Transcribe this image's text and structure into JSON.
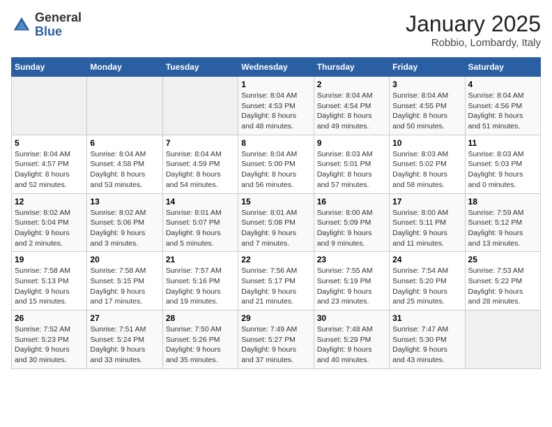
{
  "header": {
    "logo_general": "General",
    "logo_blue": "Blue",
    "month": "January 2025",
    "location": "Robbio, Lombardy, Italy"
  },
  "days_of_week": [
    "Sunday",
    "Monday",
    "Tuesday",
    "Wednesday",
    "Thursday",
    "Friday",
    "Saturday"
  ],
  "weeks": [
    [
      {
        "day": "",
        "info": ""
      },
      {
        "day": "",
        "info": ""
      },
      {
        "day": "",
        "info": ""
      },
      {
        "day": "1",
        "info": "Sunrise: 8:04 AM\nSunset: 4:53 PM\nDaylight: 8 hours\nand 48 minutes."
      },
      {
        "day": "2",
        "info": "Sunrise: 8:04 AM\nSunset: 4:54 PM\nDaylight: 8 hours\nand 49 minutes."
      },
      {
        "day": "3",
        "info": "Sunrise: 8:04 AM\nSunset: 4:55 PM\nDaylight: 8 hours\nand 50 minutes."
      },
      {
        "day": "4",
        "info": "Sunrise: 8:04 AM\nSunset: 4:56 PM\nDaylight: 8 hours\nand 51 minutes."
      }
    ],
    [
      {
        "day": "5",
        "info": "Sunrise: 8:04 AM\nSunset: 4:57 PM\nDaylight: 8 hours\nand 52 minutes."
      },
      {
        "day": "6",
        "info": "Sunrise: 8:04 AM\nSunset: 4:58 PM\nDaylight: 8 hours\nand 53 minutes."
      },
      {
        "day": "7",
        "info": "Sunrise: 8:04 AM\nSunset: 4:59 PM\nDaylight: 8 hours\nand 54 minutes."
      },
      {
        "day": "8",
        "info": "Sunrise: 8:04 AM\nSunset: 5:00 PM\nDaylight: 8 hours\nand 56 minutes."
      },
      {
        "day": "9",
        "info": "Sunrise: 8:03 AM\nSunset: 5:01 PM\nDaylight: 8 hours\nand 57 minutes."
      },
      {
        "day": "10",
        "info": "Sunrise: 8:03 AM\nSunset: 5:02 PM\nDaylight: 8 hours\nand 58 minutes."
      },
      {
        "day": "11",
        "info": "Sunrise: 8:03 AM\nSunset: 5:03 PM\nDaylight: 9 hours\nand 0 minutes."
      }
    ],
    [
      {
        "day": "12",
        "info": "Sunrise: 8:02 AM\nSunset: 5:04 PM\nDaylight: 9 hours\nand 2 minutes."
      },
      {
        "day": "13",
        "info": "Sunrise: 8:02 AM\nSunset: 5:06 PM\nDaylight: 9 hours\nand 3 minutes."
      },
      {
        "day": "14",
        "info": "Sunrise: 8:01 AM\nSunset: 5:07 PM\nDaylight: 9 hours\nand 5 minutes."
      },
      {
        "day": "15",
        "info": "Sunrise: 8:01 AM\nSunset: 5:08 PM\nDaylight: 9 hours\nand 7 minutes."
      },
      {
        "day": "16",
        "info": "Sunrise: 8:00 AM\nSunset: 5:09 PM\nDaylight: 9 hours\nand 9 minutes."
      },
      {
        "day": "17",
        "info": "Sunrise: 8:00 AM\nSunset: 5:11 PM\nDaylight: 9 hours\nand 11 minutes."
      },
      {
        "day": "18",
        "info": "Sunrise: 7:59 AM\nSunset: 5:12 PM\nDaylight: 9 hours\nand 13 minutes."
      }
    ],
    [
      {
        "day": "19",
        "info": "Sunrise: 7:58 AM\nSunset: 5:13 PM\nDaylight: 9 hours\nand 15 minutes."
      },
      {
        "day": "20",
        "info": "Sunrise: 7:58 AM\nSunset: 5:15 PM\nDaylight: 9 hours\nand 17 minutes."
      },
      {
        "day": "21",
        "info": "Sunrise: 7:57 AM\nSunset: 5:16 PM\nDaylight: 9 hours\nand 19 minutes."
      },
      {
        "day": "22",
        "info": "Sunrise: 7:56 AM\nSunset: 5:17 PM\nDaylight: 9 hours\nand 21 minutes."
      },
      {
        "day": "23",
        "info": "Sunrise: 7:55 AM\nSunset: 5:19 PM\nDaylight: 9 hours\nand 23 minutes."
      },
      {
        "day": "24",
        "info": "Sunrise: 7:54 AM\nSunset: 5:20 PM\nDaylight: 9 hours\nand 25 minutes."
      },
      {
        "day": "25",
        "info": "Sunrise: 7:53 AM\nSunset: 5:22 PM\nDaylight: 9 hours\nand 28 minutes."
      }
    ],
    [
      {
        "day": "26",
        "info": "Sunrise: 7:52 AM\nSunset: 5:23 PM\nDaylight: 9 hours\nand 30 minutes."
      },
      {
        "day": "27",
        "info": "Sunrise: 7:51 AM\nSunset: 5:24 PM\nDaylight: 9 hours\nand 33 minutes."
      },
      {
        "day": "28",
        "info": "Sunrise: 7:50 AM\nSunset: 5:26 PM\nDaylight: 9 hours\nand 35 minutes."
      },
      {
        "day": "29",
        "info": "Sunrise: 7:49 AM\nSunset: 5:27 PM\nDaylight: 9 hours\nand 37 minutes."
      },
      {
        "day": "30",
        "info": "Sunrise: 7:48 AM\nSunset: 5:29 PM\nDaylight: 9 hours\nand 40 minutes."
      },
      {
        "day": "31",
        "info": "Sunrise: 7:47 AM\nSunset: 5:30 PM\nDaylight: 9 hours\nand 43 minutes."
      },
      {
        "day": "",
        "info": ""
      }
    ]
  ]
}
